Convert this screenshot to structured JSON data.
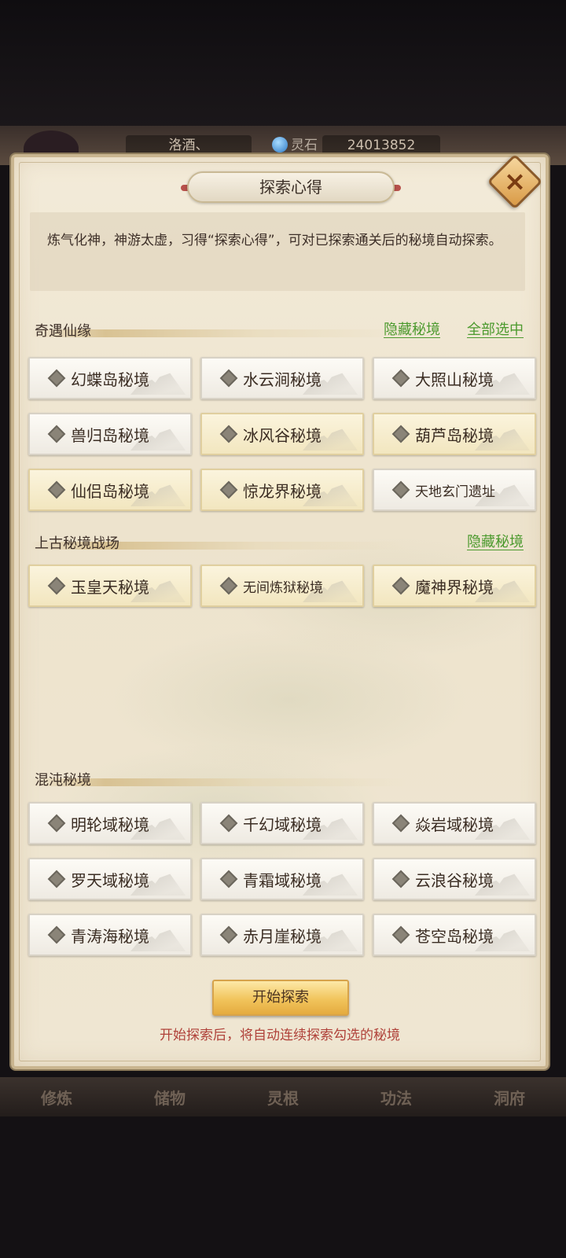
{
  "hud": {
    "player_name": "洛酒、",
    "currency_label": "灵石",
    "currency_value": "24013852"
  },
  "bottom_nav": [
    "修炼",
    "储物",
    "灵根",
    "功法",
    "洞府"
  ],
  "dialog": {
    "title": "探索心得",
    "description": "炼气化神，神游太虚，习得“探索心得”，可对已探索通关后的秘境自动探索。",
    "sections": [
      {
        "title": "奇遇仙缘",
        "hide_link": "隐藏秘境",
        "select_all_link": "全部选中",
        "items": [
          "幻蝶岛秘境",
          "水云涧秘境",
          "大照山秘境",
          "兽归岛秘境",
          "冰风谷秘境",
          "葫芦岛秘境",
          "仙侣岛秘境",
          "惊龙界秘境",
          "天地玄门遗址"
        ]
      },
      {
        "title": "上古秘境战场",
        "hide_link": "隐藏秘境",
        "items": [
          "玉皇天秘境",
          "无间炼狱秘境",
          "魔神界秘境"
        ]
      },
      {
        "title": "混沌秘境",
        "items": [
          "明轮域秘境",
          "千幻域秘境",
          "焱岩域秘境",
          "罗天域秘境",
          "青霜域秘境",
          "云浪谷秘境",
          "青涛海秘境",
          "赤月崖秘境",
          "苍空岛秘境"
        ]
      }
    ],
    "start_button": "开始探索",
    "hint": "开始探索后，将自动连续探索勾选的秘境"
  },
  "colors": {
    "link_green": "#4c9a2e",
    "hint_red": "#b0423a",
    "button_gold": "#f1c45c"
  }
}
